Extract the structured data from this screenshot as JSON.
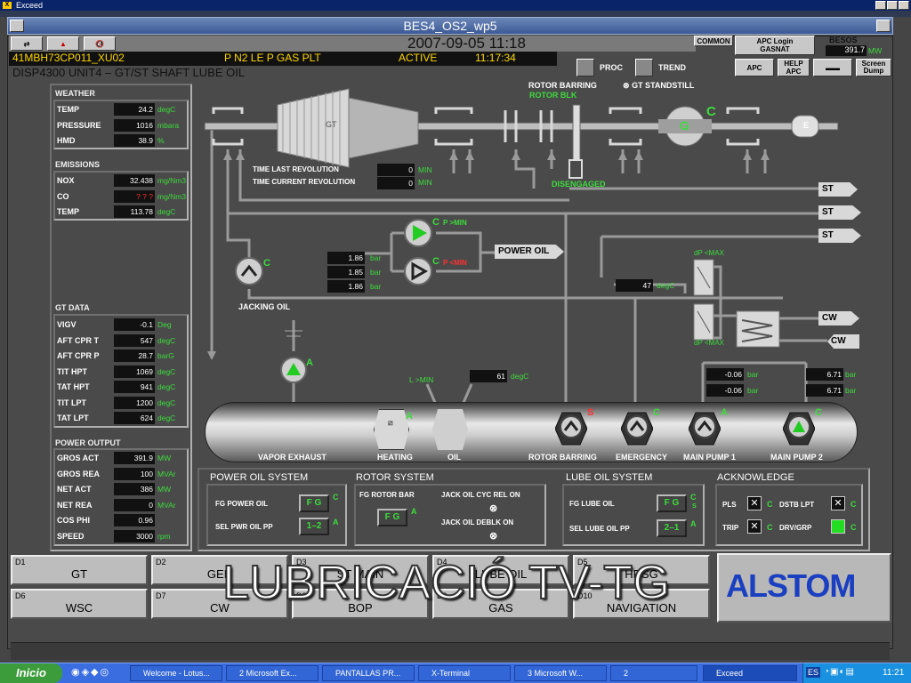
{
  "os_window": {
    "title": "Exceed"
  },
  "inner_window": {
    "title": "BES4_OS2_wp5"
  },
  "header": {
    "datetime": "2007-09-05  11:18",
    "alarm_tag": "41MBH73CP011_XU02",
    "alarm_text": "P N2 LE P GAS PLT",
    "alarm_state": "ACTIVE",
    "alarm_time": "11:17:34",
    "display_title": "DISP4300  UNIT4 – GT/ST SHAFT LUBE OIL",
    "proc_label": "PROC",
    "trend_label": "TREND",
    "common_label": "COMMON",
    "apc_login_label": "APC Login",
    "apc_login_user": "GASNAT",
    "apc_label": "APC",
    "help_apc_label": "HELP APC",
    "screen_dump_label": "Screen Dump",
    "besos_label": "BESOS",
    "besos_value": "391.7",
    "besos_unit": "MW"
  },
  "weather": {
    "title": "WEATHER",
    "rows": [
      {
        "label": "TEMP",
        "value": "24.2",
        "unit": "degC"
      },
      {
        "label": "PRESSURE",
        "value": "1016",
        "unit": "mbara"
      },
      {
        "label": "HMD",
        "value": "38.9",
        "unit": "%"
      }
    ]
  },
  "emissions": {
    "title": "EMISSIONS",
    "rows": [
      {
        "label": "NOX",
        "value": "32.438",
        "unit": "mg/Nm3"
      },
      {
        "label": "CO",
        "value": "? ? ?",
        "unit": "mg/Nm3"
      },
      {
        "label": "TEMP",
        "value": "113.78",
        "unit": "degC"
      }
    ]
  },
  "gt_data": {
    "title": "GT DATA",
    "rows": [
      {
        "label": "VIGV",
        "value": "-0.1",
        "unit": "Deg"
      },
      {
        "label": "AFT CPR T",
        "value": "547",
        "unit": "degC"
      },
      {
        "label": "AFT CPR P",
        "value": "28.7",
        "unit": "barG"
      },
      {
        "label": "TIT HPT",
        "value": "1069",
        "unit": "degC"
      },
      {
        "label": "TAT HPT",
        "value": "941",
        "unit": "degC"
      },
      {
        "label": "TIT LPT",
        "value": "1200",
        "unit": "degC"
      },
      {
        "label": "TAT LPT",
        "value": "624",
        "unit": "degC"
      }
    ]
  },
  "power_output": {
    "title": "POWER OUTPUT",
    "rows": [
      {
        "label": "GROS ACT",
        "value": "391.9",
        "unit": "MW"
      },
      {
        "label": "GROS REA",
        "value": "100",
        "unit": "MVAr"
      },
      {
        "label": "NET ACT",
        "value": "386",
        "unit": "MW"
      },
      {
        "label": "NET REA",
        "value": "0",
        "unit": "MVAr"
      },
      {
        "label": "COS PHI",
        "value": "0.96",
        "unit": ""
      },
      {
        "label": "SPEED",
        "value": "3000",
        "unit": "rpm"
      }
    ]
  },
  "diagram": {
    "gt_label": "GT",
    "g_label": "G",
    "c_label": "C",
    "e_label": "E",
    "rotor_barring": "ROTOR BARRING",
    "rotor_blk": "ROTOR BLK",
    "gt_standstill": "GT STANDSTILL",
    "disengaged": "DISENGAGED",
    "time_last_rev_label": "TIME LAST REVOLUTION",
    "time_last_rev_value": "0",
    "time_cur_rev_label": "TIME CURRENT REVOLUTION",
    "time_cur_rev_value": "0",
    "min_unit": "MIN",
    "st1": "ST",
    "st2": "ST",
    "st3": "ST",
    "power_oil": "POWER OIL",
    "p_min1": "P >MIN",
    "p_min2": "P <MIN",
    "bar1": "1.86",
    "bar2": "1.85",
    "bar3": "1.86",
    "bar_unit": "bar",
    "jacking_oil": "JACKING OIL",
    "cooler_temp": "47",
    "degc": "degC",
    "dp_max1": "dP <MAX",
    "dp_max2": "dP <MAX",
    "cw1": "CW",
    "cw2": "CW",
    "p_left1": "-0.06",
    "p_left2": "-0.06",
    "p_right1": "6.71",
    "p_right2": "6.71",
    "l_min": "L >MIN",
    "tank_temp": "61",
    "a": "A",
    "s": "S",
    "vapor_exhaust": "VAPOR EXHAUST",
    "heating": "HEATING",
    "oil": "OIL",
    "rotor_barring_pump": "ROTOR BARRING",
    "emergency": "EMERGENCY",
    "main_pump1": "MAIN PUMP 1",
    "main_pump2": "MAIN PUMP 2"
  },
  "systems": {
    "power_oil": {
      "title": "POWER OIL SYSTEM",
      "fg_label": "FG POWER OIL",
      "fg_value": "F G",
      "sel_label": "SEL PWR OIL PP",
      "sel_value": "1–2",
      "c": "C",
      "a": "A"
    },
    "rotor": {
      "title": "ROTOR SYSTEM",
      "fg_label": "FG ROTOR BAR",
      "fg_value": "F G",
      "a": "A",
      "jack1": "JACK OIL CYC REL ON",
      "jack2": "JACK OIL DEBLK ON"
    },
    "lube": {
      "title": "LUBE OIL SYSTEM",
      "fg_label": "FG LUBE OIL",
      "fg_value": "F G",
      "sel_label": "SEL LUBE OIL PP",
      "sel_value": "2–1",
      "c": "C",
      "s": "S",
      "a": "A"
    },
    "ack": {
      "title": "ACKNOWLEDGE",
      "pls": "PLS",
      "trip": "TRIP",
      "dstb": "DSTB LPT",
      "drv": "DRV/GRP",
      "c": "C"
    }
  },
  "nav": [
    {
      "id": "D1",
      "label": "GT"
    },
    {
      "id": "D2",
      "label": "GEN"
    },
    {
      "id": "D3",
      "label": "ST MAIN"
    },
    {
      "id": "D4",
      "label": "LUBE OIL"
    },
    {
      "id": "D5",
      "label": "HRSG"
    },
    {
      "id": "D6",
      "label": "WSC"
    },
    {
      "id": "D7",
      "label": "CW"
    },
    {
      "id": "D8",
      "label": "BOP"
    },
    {
      "id": "D9",
      "label": "GAS"
    },
    {
      "id": "D10",
      "label": "NAVIGATION"
    }
  ],
  "overlay_title": "LUBRICACIÓ TV-TG",
  "brand": {
    "text": "ALSTOM"
  },
  "taskbar": {
    "start": "Inicio",
    "items": [
      "Welcome - Lotus...",
      "2 Microsoft Ex...",
      "PANTALLAS PR...",
      "X-Terminal",
      "3 Microsoft W...",
      "2",
      "Exceed"
    ],
    "lang": "ES",
    "time": "11:21"
  }
}
